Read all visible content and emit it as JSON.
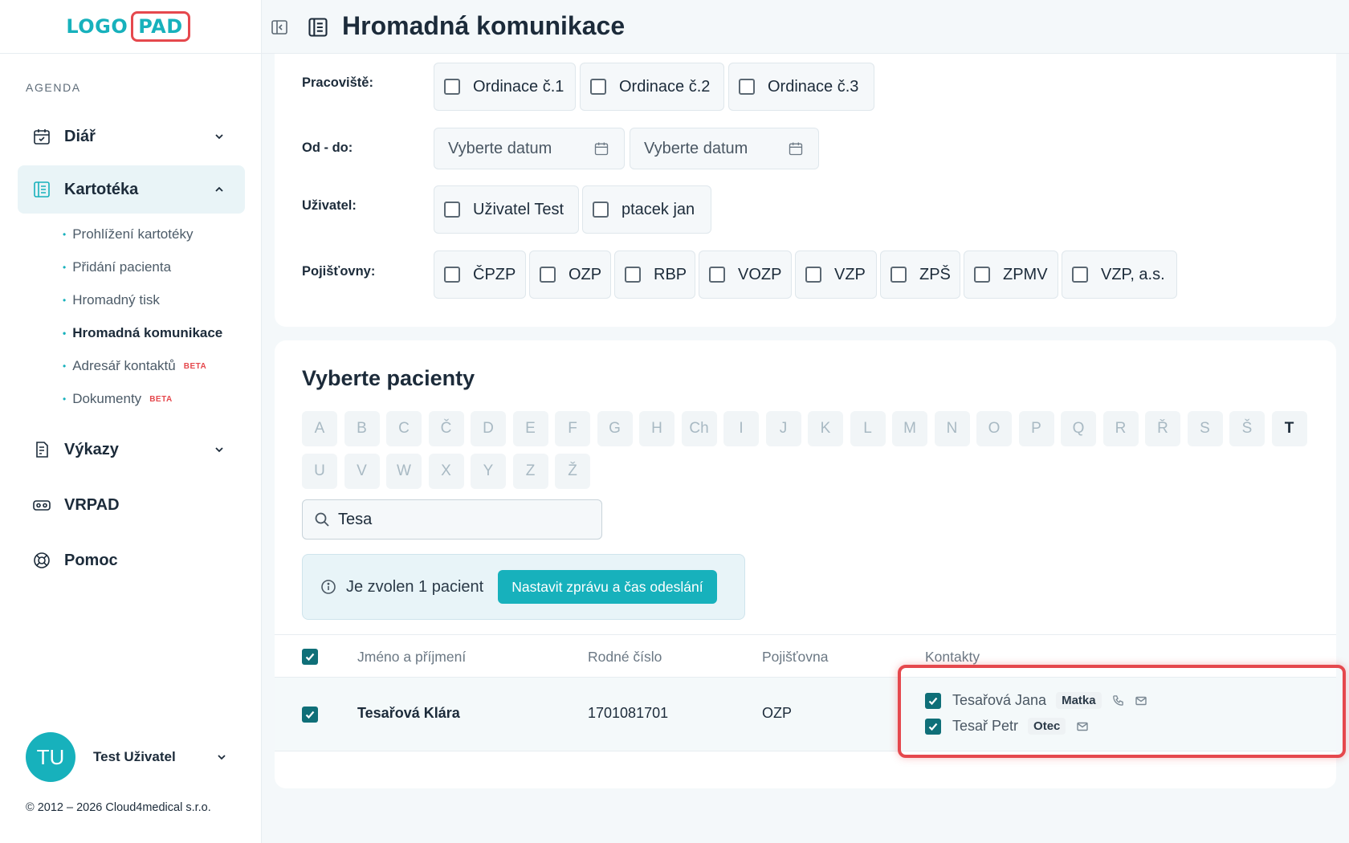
{
  "logo": {
    "part1": "LOGO",
    "part2": "PAD"
  },
  "sidebar": {
    "section": "AGENDA",
    "items": [
      {
        "label": "Diář",
        "icon": "calendar-icon"
      },
      {
        "label": "Kartotéka",
        "icon": "file-cabinet-icon"
      },
      {
        "label": "Výkazy",
        "icon": "report-icon"
      },
      {
        "label": "VRPAD",
        "icon": "vr-headset-icon"
      },
      {
        "label": "Pomoc",
        "icon": "lifebuoy-icon"
      }
    ],
    "subitems": [
      {
        "label": "Prohlížení kartotéky"
      },
      {
        "label": "Přidání pacienta"
      },
      {
        "label": "Hromadný tisk"
      },
      {
        "label": "Hromadná komunikace"
      },
      {
        "label": "Adresář kontaktů",
        "badge": "BETA"
      },
      {
        "label": "Dokumenty",
        "badge": "BETA"
      }
    ],
    "user": {
      "initials": "TU",
      "name": "Test Uživatel"
    },
    "copyright": "© 2012 – 2026 Cloud4medical s.r.o."
  },
  "header": {
    "title": "Hromadná komunikace"
  },
  "filters": {
    "workplace": {
      "label": "Pracoviště:",
      "options": [
        "Ordinace č.1",
        "Ordinace č.2",
        "Ordinace č.3"
      ]
    },
    "dates": {
      "label": "Od - do:",
      "from": "Vyberte datum",
      "to": "Vyberte datum"
    },
    "user": {
      "label": "Uživatel:",
      "options": [
        "Uživatel Test",
        "ptacek jan"
      ]
    },
    "insurers": {
      "label": "Pojišťovny:",
      "options": [
        "ČPZP",
        "OZP",
        "RBP",
        "VOZP",
        "VZP",
        "ZPŠ",
        "ZPMV",
        "VZP, a.s."
      ]
    }
  },
  "patients": {
    "title": "Vyberte pacienty",
    "letters_row1": [
      "A",
      "B",
      "C",
      "Č",
      "D",
      "E",
      "F",
      "G",
      "H",
      "Ch",
      "I",
      "J",
      "K",
      "L",
      "M",
      "N",
      "O",
      "P",
      "Q",
      "R",
      "Ř",
      "S",
      "Š",
      "T"
    ],
    "letters_row2": [
      "U",
      "V",
      "W",
      "X",
      "Y",
      "Z",
      "Ž"
    ],
    "enabled_letter": "T",
    "search_value": "Tesa",
    "info_text": "Je zvolen 1 pacient",
    "action_button": "Nastavit zprávu a čas odeslání",
    "table": {
      "headers": [
        "Jméno a příjmení",
        "Rodné číslo",
        "Pojišťovna",
        "Kontakty"
      ],
      "rows": [
        {
          "name": "Tesařová Klára",
          "birth_number": "1701081701",
          "insurer": "OZP",
          "contacts": [
            {
              "name": "Tesařová Jana",
              "relation": "Matka",
              "phone": true,
              "email": true
            },
            {
              "name": "Tesař Petr",
              "relation": "Otec",
              "phone": false,
              "email": true
            }
          ]
        }
      ]
    }
  },
  "colors": {
    "accent": "#17b1bc",
    "highlight": "#e5484d",
    "text": "#1c2b3a"
  }
}
